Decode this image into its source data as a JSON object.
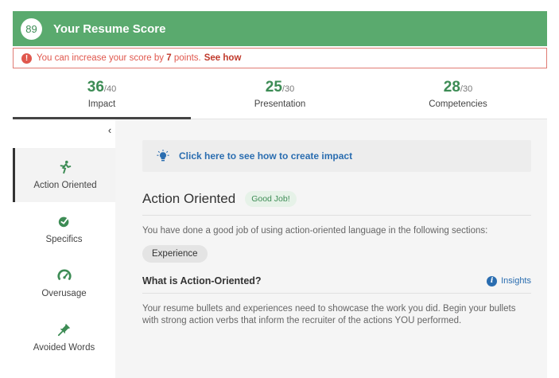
{
  "header": {
    "score": "89",
    "title": "Your Resume Score",
    "color": "#5aaa6e"
  },
  "alert": {
    "prefix": "You can increase your score by",
    "points": "7",
    "suffix": "points.",
    "link": "See how"
  },
  "tabs": [
    {
      "score": "36",
      "max": "/40",
      "label": "Impact"
    },
    {
      "score": "25",
      "max": "/30",
      "label": "Presentation"
    },
    {
      "score": "28",
      "max": "/30",
      "label": "Competencies"
    }
  ],
  "sidebar": {
    "collapse_icon": "chevron-left-icon",
    "items": [
      {
        "label": "Action Oriented",
        "icon": "runner-icon"
      },
      {
        "label": "Specifics",
        "icon": "target-check-icon"
      },
      {
        "label": "Overusage",
        "icon": "gauge-icon"
      },
      {
        "label": "Avoided Words",
        "icon": "pin-icon"
      }
    ]
  },
  "content": {
    "tip": "Click here to see how to create impact",
    "section_title": "Action Oriented",
    "badge": "Good Job!",
    "description": "You have done a good job of using action-oriented language in the following sections:",
    "chip": "Experience",
    "what_title": "What is Action-Oriented?",
    "insights_label": "Insights",
    "explanation": "Your resume bullets and experiences need to showcase the work you did. Begin your bullets with strong action verbs that inform the recruiter of the actions YOU performed."
  }
}
